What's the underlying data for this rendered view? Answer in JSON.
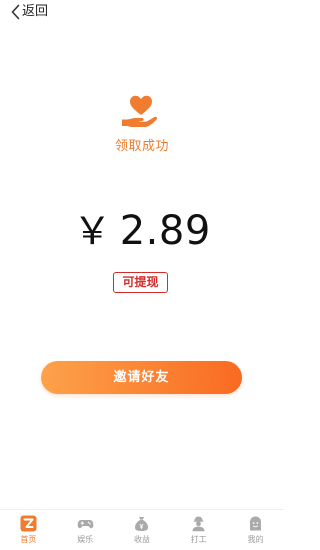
{
  "header": {
    "back_label": "返回"
  },
  "success": {
    "text": "领取成功",
    "icon": "heart-hand-icon"
  },
  "amount": {
    "currency": "￥",
    "value": "2.89"
  },
  "withdraw_tag": "可提现",
  "invite_button": "邀请好友",
  "nav": {
    "items": [
      {
        "label": "首页",
        "icon": "home-z-icon",
        "active": true
      },
      {
        "label": "娱乐",
        "icon": "gamepad-icon",
        "active": false
      },
      {
        "label": "收益",
        "icon": "money-bag-icon",
        "active": false
      },
      {
        "label": "打工",
        "icon": "worker-icon",
        "active": false
      },
      {
        "label": "我的",
        "icon": "profile-icon",
        "active": false
      }
    ]
  },
  "colors": {
    "accent": "#f07d2f",
    "tag_red": "#d22d2d",
    "button_start": "#fda24a",
    "button_end": "#f96a22"
  }
}
